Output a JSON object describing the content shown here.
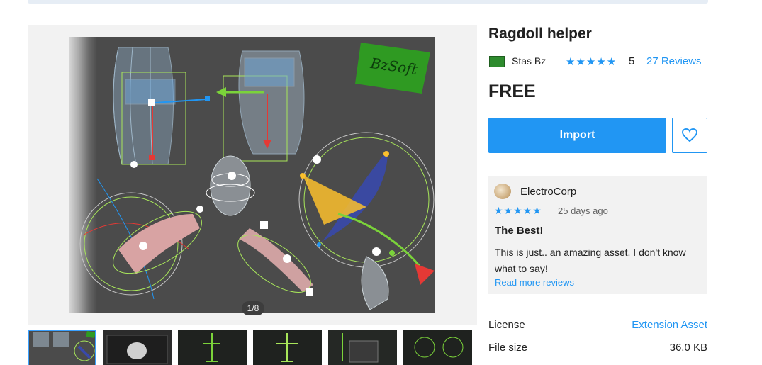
{
  "product": {
    "title": "Ragdoll helper",
    "publisher": "Stas Bz",
    "rating_stars": "★★★★★",
    "rating_value": "5",
    "reviews_link": "27 Reviews",
    "price": "FREE",
    "import_label": "Import"
  },
  "gallery": {
    "counter": "1/8",
    "watermark": "BzSoft",
    "thumbnail_count": 6
  },
  "review": {
    "author": "ElectroCorp",
    "stars": "★★★★★",
    "date": "25 days ago",
    "title": "The Best!",
    "body": "This is just.. an amazing asset. I don't know what to say!",
    "more_link": "Read more reviews"
  },
  "info": [
    {
      "label": "License",
      "value": "Extension Asset"
    },
    {
      "label": "File size",
      "value": "36.0 KB"
    }
  ],
  "colors": {
    "accent": "#2196f3",
    "text": "#212121",
    "panel": "#f2f2f2",
    "viewer_bg": "#4b4b4b"
  },
  "icons": {
    "share": "share-icon",
    "fullscreen": "fullscreen-icon",
    "wishlist": "heart-icon",
    "publisher_logo": "bzsoft-logo"
  }
}
